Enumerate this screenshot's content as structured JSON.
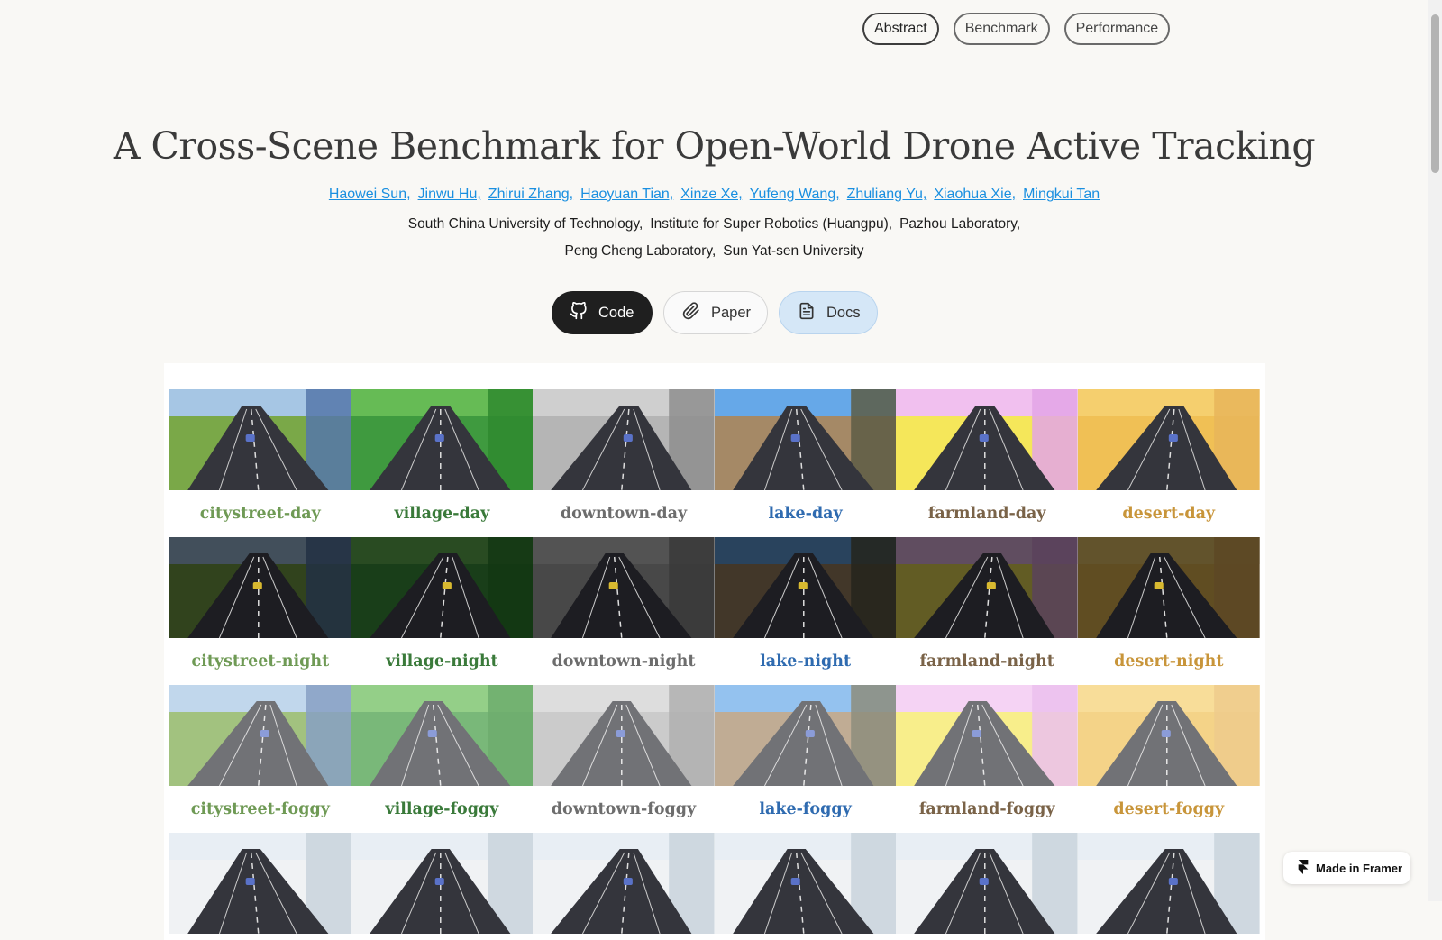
{
  "nav": [
    {
      "label": "Abstract",
      "active": true
    },
    {
      "label": "Benchmark",
      "active": false
    },
    {
      "label": "Performance",
      "active": false
    }
  ],
  "title": "A Cross-Scene Benchmark for Open-World Drone Active Tracking",
  "authors": [
    "Haowei Sun,",
    "Jinwu Hu,",
    "Zhirui Zhang,",
    "Haoyuan Tian,",
    "Xinze Xe,",
    "Yufeng Wang,",
    "Zhuliang Yu,",
    "Xiaohua Xie,",
    "Mingkui Tan"
  ],
  "affiliations_line1": [
    "South China University of Technology,",
    "Institute for Super Robotics (Huangpu),",
    "Pazhou Laboratory,"
  ],
  "affiliations_line2": [
    "Peng Cheng Laboratory,",
    "Sun Yat-sen University"
  ],
  "buttons": {
    "code": "Code",
    "paper": "Paper",
    "docs": "Docs"
  },
  "scenes": [
    {
      "name": "citystreet",
      "color": "#6f9a55",
      "ground": "#7aa848",
      "sky": "#a6c6e4",
      "side": "#5577aa"
    },
    {
      "name": "village",
      "color": "#3a7a3a",
      "ground": "#3f9a3f",
      "sky": "#66bb55",
      "side": "#2f8a2f"
    },
    {
      "name": "downtown",
      "color": "#6d6d6d",
      "ground": "#b5b5b5",
      "sky": "#cfcfcf",
      "side": "#8e8e8e"
    },
    {
      "name": "lake",
      "color": "#2f6bb0",
      "ground": "#a58966",
      "sky": "#66a8e8",
      "side": "#5d5d45"
    },
    {
      "name": "farmland",
      "color": "#7a6348",
      "ground": "#f5e75a",
      "sky": "#f1c0ef",
      "side": "#e3a5e6"
    },
    {
      "name": "desert",
      "color": "#c8953a",
      "ground": "#f0c055",
      "sky": "#f5cf6e",
      "side": "#e8b55a"
    }
  ],
  "conditions": [
    "day",
    "night",
    "foggy"
  ],
  "framer": "Made in Framer"
}
